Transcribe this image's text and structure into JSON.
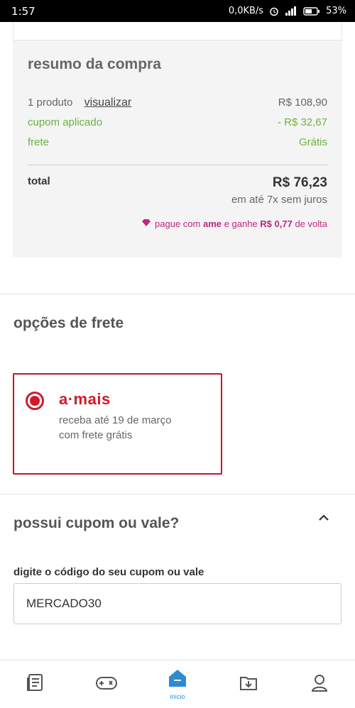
{
  "status_bar": {
    "time": "1:57",
    "network_speed": "0,0KB/s",
    "battery": "53%"
  },
  "summary": {
    "title": "resumo da compra",
    "products_label": "1 produto",
    "view_link": "visualizar",
    "products_value": "R$ 108,90",
    "coupon_label": "cupom aplicado",
    "coupon_value": "- R$ 32,67",
    "shipping_label": "frete",
    "shipping_value": "Grátis",
    "total_label": "total",
    "total_value": "R$ 76,23",
    "installments": "em até 7x sem juros",
    "ame_pre": "pague com",
    "ame_brand": "ame",
    "ame_mid": "e ganhe",
    "ame_amount": "R$ 0,77",
    "ame_post": "de volta"
  },
  "freight": {
    "title": "opções de frete",
    "option_brand": "a·mais",
    "option_line1": "receba até 19 de março",
    "option_line2": "com frete grátis"
  },
  "coupon": {
    "title": "possui cupom ou vale?",
    "field_label": "digite o código do seu cupom ou vale",
    "field_value": "MERCADO30"
  },
  "bottom_nav": {
    "home_label": "início"
  },
  "colors": {
    "brand_red": "#d11a2a",
    "green": "#6cb33f",
    "ame_pink": "#c0267f",
    "nav_blue": "#2d8bd6"
  },
  "icons": [
    "alarm-icon",
    "signal-icon",
    "battery-icon",
    "diamond-icon",
    "chevron-up-icon",
    "list-icon",
    "gamepad-icon",
    "home-icon",
    "download-folder-icon",
    "user-icon"
  ]
}
